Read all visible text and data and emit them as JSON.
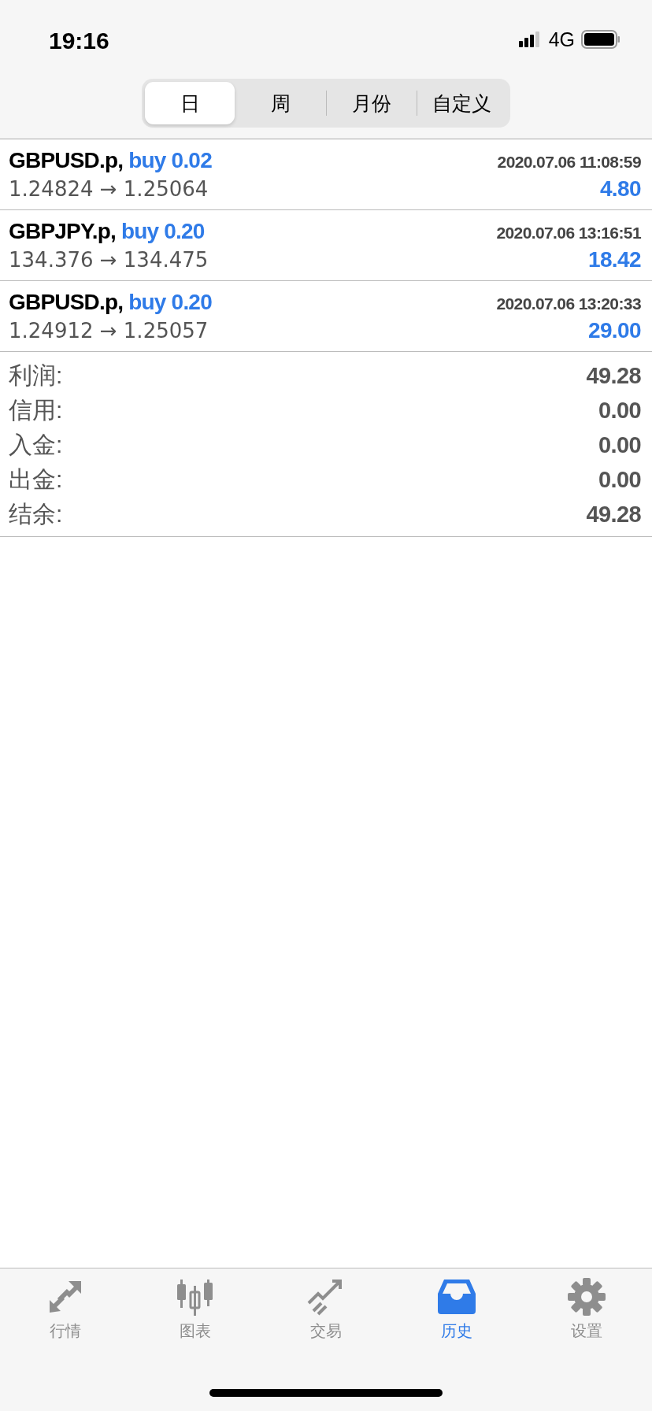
{
  "status_bar": {
    "time": "19:16",
    "network": "4G"
  },
  "segments": [
    {
      "label": "日",
      "selected": true
    },
    {
      "label": "周",
      "selected": false
    },
    {
      "label": "月份",
      "selected": false
    },
    {
      "label": "自定义",
      "selected": false
    }
  ],
  "deals": [
    {
      "symbol": "GBPUSD.p,",
      "action": "buy 0.02",
      "time": "2020.07.06 11:08:59",
      "prices": "1.24824 → 1.25064",
      "profit": "4.80"
    },
    {
      "symbol": "GBPJPY.p,",
      "action": "buy 0.20",
      "time": "2020.07.06 13:16:51",
      "prices": "134.376 → 134.475",
      "profit": "18.42"
    },
    {
      "symbol": "GBPUSD.p,",
      "action": "buy 0.20",
      "time": "2020.07.06 13:20:33",
      "prices": "1.24912 → 1.25057",
      "profit": "29.00"
    }
  ],
  "summary": [
    {
      "label": "利润:",
      "value": "49.28"
    },
    {
      "label": "信用:",
      "value": "0.00"
    },
    {
      "label": "入金:",
      "value": "0.00"
    },
    {
      "label": "出金:",
      "value": "0.00"
    },
    {
      "label": "结余:",
      "value": "49.28"
    }
  ],
  "tab_bar": [
    {
      "label": "行情",
      "selected": false
    },
    {
      "label": "图表",
      "selected": false
    },
    {
      "label": "交易",
      "selected": false
    },
    {
      "label": "历史",
      "selected": true
    },
    {
      "label": "设置",
      "selected": false
    }
  ]
}
